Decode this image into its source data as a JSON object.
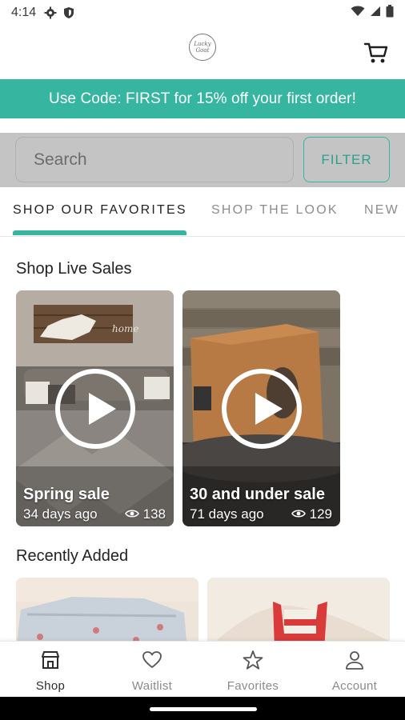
{
  "status_bar": {
    "time": "4:14",
    "icons_left": [
      "gear-icon",
      "shield-icon"
    ],
    "icons_right": [
      "wifi-icon",
      "signal-icon",
      "battery-icon"
    ]
  },
  "header": {
    "logo_text": "Lucky Goat",
    "cart_icon": "cart-icon"
  },
  "promo_banner": {
    "text": "Use Code: FIRST for 15% off your first order!",
    "color": "#36b6a1"
  },
  "search": {
    "placeholder": "Search",
    "filter_label": "FILTER"
  },
  "tabs": [
    {
      "label": "SHOP OUR FAVORITES",
      "active": true
    },
    {
      "label": "SHOP THE LOOK",
      "active": false
    },
    {
      "label": "NEW",
      "active": false
    }
  ],
  "live_sales": {
    "title": "Shop Live Sales",
    "cards": [
      {
        "title": "Spring sale",
        "age": "34 days ago",
        "views": "138"
      },
      {
        "title": "30 and under sale",
        "age": "71 days ago",
        "views": "129"
      }
    ]
  },
  "recently_added": {
    "title": "Recently Added"
  },
  "bottom_nav": [
    {
      "label": "Shop",
      "icon": "shop-icon",
      "active": true
    },
    {
      "label": "Waitlist",
      "icon": "heart-icon",
      "active": false
    },
    {
      "label": "Favorites",
      "icon": "star-icon",
      "active": false
    },
    {
      "label": "Account",
      "icon": "person-icon",
      "active": false
    }
  ],
  "colors": {
    "accent": "#36b6a1",
    "search_bg": "#c4c4c4"
  }
}
